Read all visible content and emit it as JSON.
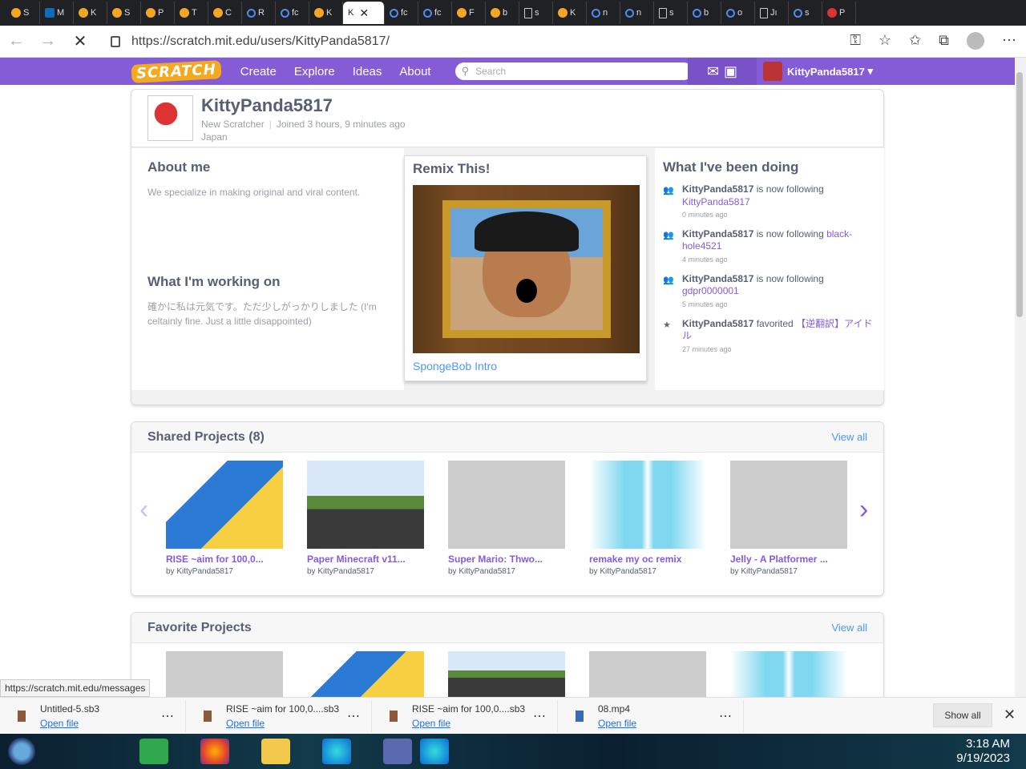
{
  "browser": {
    "url": "https://scratch.mit.edu/users/KittyPanda5817/",
    "tabs": [
      "S",
      "M",
      "K",
      "S",
      "P",
      "T",
      "C",
      "R",
      "fc",
      "K",
      "K",
      "fc",
      "fc",
      "F",
      "b",
      "s",
      "K",
      "n",
      "n",
      "s",
      "b",
      "o",
      "Jı",
      "s",
      "P"
    ]
  },
  "nav": {
    "logo": "SCRATCH",
    "links": [
      "Create",
      "Explore",
      "Ideas",
      "About"
    ],
    "search_placeholder": "Search",
    "username": "KittyPanda5817"
  },
  "profile": {
    "username": "KittyPanda5817",
    "status": "New Scratcher",
    "joined": "Joined 3 hours, 9 minutes ago",
    "country": "Japan",
    "about_title": "About me",
    "about_text": "We specialize in making original and viral content.",
    "working_title": "What I'm working on",
    "working_text": "確かに私は元気です。ただ少しがっかりしました (I'm celtainly fine. Just a little disappointed)"
  },
  "remix": {
    "title": "Remix This!",
    "project_name": "SpongeBob Intro"
  },
  "activity": {
    "title": "What I've been doing",
    "items": [
      {
        "user": "KittyPanda5817",
        "action": " is now following ",
        "target": "KittyPanda5817",
        "time": "0 minutes ago",
        "icon": "follow-icon"
      },
      {
        "user": "KittyPanda5817",
        "action": " is now following ",
        "target": "black-hole4521",
        "time": "4 minutes ago",
        "icon": "follow-icon"
      },
      {
        "user": "KittyPanda5817",
        "action": " is now following ",
        "target": "gdpr0000001",
        "time": "5 minutes ago",
        "icon": "follow-icon"
      },
      {
        "user": "KittyPanda5817",
        "action": " favorited ",
        "target": "【逆翻訳】アイドル",
        "time": "27 minutes ago",
        "icon": "star-icon"
      }
    ]
  },
  "shared": {
    "title": "Shared Projects (8)",
    "view_all": "View all",
    "projects": [
      {
        "title": "RISE ~aim for 100,0...",
        "by": "by KittyPanda5817"
      },
      {
        "title": "Paper Minecraft v11...",
        "by": "by KittyPanda5817"
      },
      {
        "title": "Super Mario: Thwo...",
        "by": "by KittyPanda5817"
      },
      {
        "title": "remake my oc remix",
        "by": "by KittyPanda5817"
      },
      {
        "title": "Jelly - A Platformer ...",
        "by": "by KittyPanda5817"
      }
    ]
  },
  "favorites": {
    "title": "Favorite Projects",
    "view_all": "View all"
  },
  "status_url": "https://scratch.mit.edu/messages",
  "downloads": [
    {
      "name": "Untitled-5.sb3",
      "open": "Open file"
    },
    {
      "name": "RISE ~aim for 100,0....sb3",
      "open": "Open file"
    },
    {
      "name": "RISE ~aim for 100,0....sb3",
      "open": "Open file"
    },
    {
      "name": "08.mp4",
      "open": "Open file"
    }
  ],
  "show_all": "Show all",
  "clock": {
    "time": "3:18 AM",
    "date": "9/19/2023"
  }
}
